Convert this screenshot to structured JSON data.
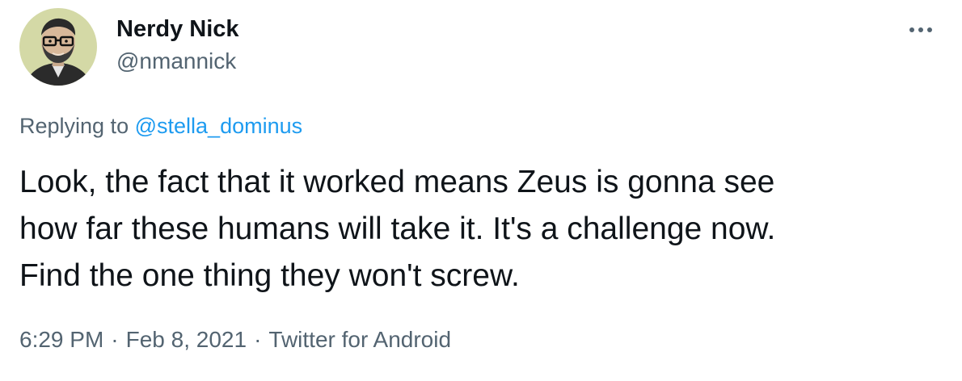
{
  "user": {
    "display_name": "Nerdy Nick",
    "handle": "@nmannick"
  },
  "reply": {
    "prefix": "Replying to",
    "mention": "@stella_dominus"
  },
  "tweet": {
    "lines": [
      "Look, the fact that it worked means Zeus is gonna see",
      "how far these humans will take it. It's a challenge now.",
      "Find the one thing they won't screw."
    ]
  },
  "meta": {
    "time": "6:29 PM",
    "date": "Feb 8, 2021",
    "source": "Twitter for Android",
    "separator": "·"
  },
  "icons": {
    "more": "more-options-icon",
    "avatar": "avatar-photo"
  },
  "colors": {
    "text": "#0f1419",
    "secondary": "#536471",
    "link": "#1d9bf0",
    "avatar_background": "#d4d9a6"
  }
}
